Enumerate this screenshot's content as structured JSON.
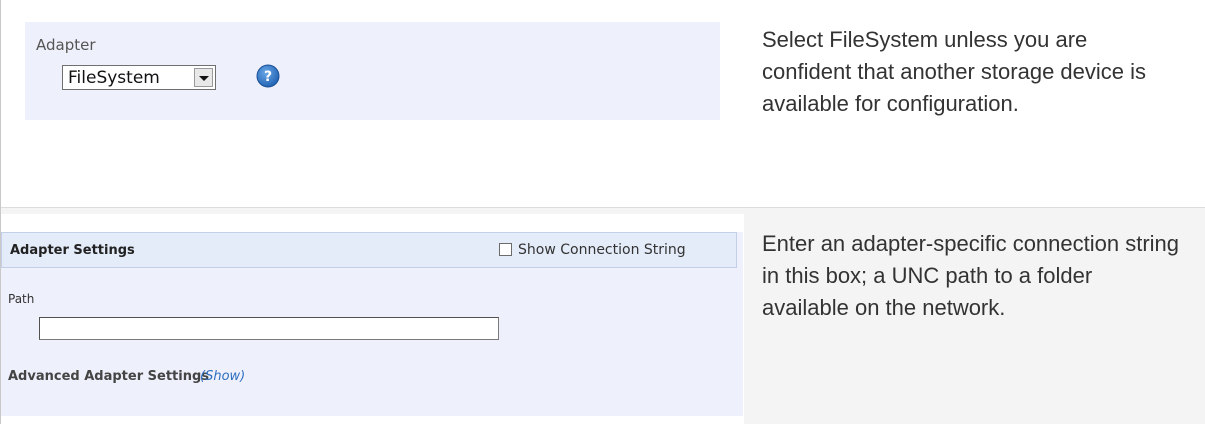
{
  "adapter": {
    "label": "Adapter",
    "selected": "FileSystem",
    "help_icon": "question-circle-icon",
    "description": "Select FileSystem unless you are confident that another storage device is available for configuration."
  },
  "adapter_settings": {
    "title": "Adapter Settings",
    "show_connection_string_label": "Show Connection String",
    "show_connection_string_checked": false,
    "path_label": "Path",
    "path_value": "",
    "advanced_label": "Advanced Adapter Settings",
    "advanced_toggle": "(Show)",
    "description": "Enter an adapter-specific connection string in this box; a UNC path to a folder available on the network."
  },
  "colors": {
    "panel_bg": "#eef1fb",
    "header_bg": "#e4ebf9",
    "link": "#2f6fc0",
    "help_icon": "#2f74c6"
  }
}
